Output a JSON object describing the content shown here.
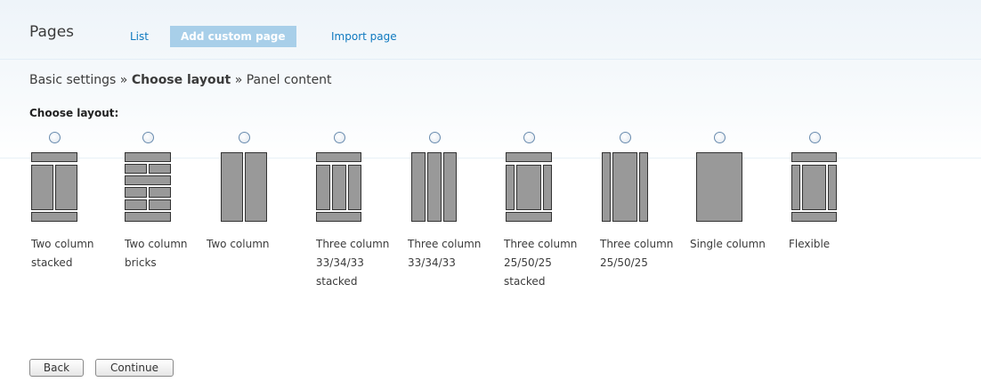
{
  "header": {
    "title": "Pages",
    "tabs": [
      {
        "label": "List",
        "active": false
      },
      {
        "label": "Add custom page",
        "active": true
      },
      {
        "label": "Import page",
        "active": false
      }
    ]
  },
  "breadcrumb": {
    "step1": "Basic settings",
    "sep1": "»",
    "step2": "Choose layout",
    "sep2": "»",
    "step3": "Panel content"
  },
  "layout_section": {
    "label": "Choose layout:",
    "options": [
      {
        "label": "Two column stacked",
        "icon": "layout-twocol-stacked-icon"
      },
      {
        "label": "Two column bricks",
        "icon": "layout-twocol-bricks-icon"
      },
      {
        "label": "Two column",
        "icon": "layout-twocol-icon"
      },
      {
        "label": "Three column 33/34/33 stacked",
        "icon": "layout-threecol-33-34-33-stacked-icon"
      },
      {
        "label": "Three column 33/34/33",
        "icon": "layout-threecol-33-34-33-icon"
      },
      {
        "label": "Three column 25/50/25 stacked",
        "icon": "layout-threecol-25-50-25-stacked-icon"
      },
      {
        "label": "Three column 25/50/25",
        "icon": "layout-threecol-25-50-25-icon"
      },
      {
        "label": "Single column",
        "icon": "layout-onecol-icon"
      },
      {
        "label": "Flexible",
        "icon": "layout-flexible-icon"
      }
    ]
  },
  "buttons": {
    "back": "Back",
    "continue": "Continue"
  },
  "colors": {
    "tab_active_bg": "#a8cfe9",
    "link": "#0f79bf",
    "layout_fill": "#999999",
    "layout_stroke": "#333333"
  }
}
